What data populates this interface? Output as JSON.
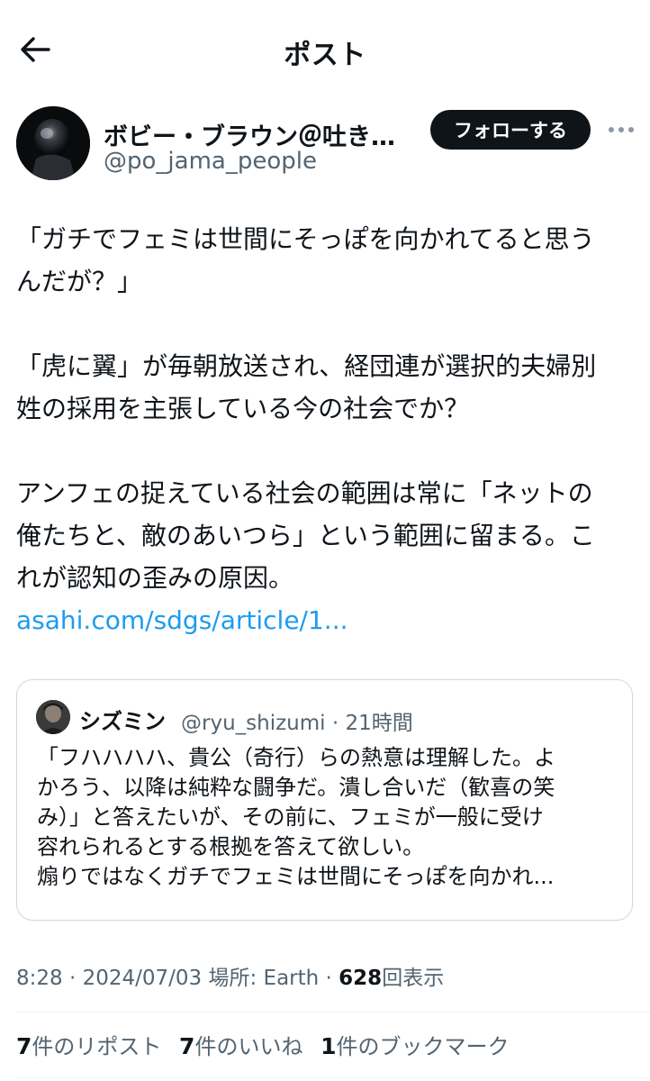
{
  "header": {
    "title": "ポスト",
    "back_icon": "arrow-left-icon"
  },
  "author": {
    "display_name": "ボビー・ブラウン＠吐き気…",
    "handle": "@po_jama_people",
    "follow_label": "フォローする",
    "more_icon": "more-horizontal-icon"
  },
  "post": {
    "lines": [
      "「ガチでフェミは世間にそっぽを向かれてると思う",
      "んだが？」",
      "",
      "「虎に翼」が毎朝放送され、経団連が選択的夫婦別",
      "姓の採用を主張している今の社会でか？",
      "",
      "アンフェの捉えている社会の範囲は常に「ネットの",
      "俺たちと、敵のあいつら」という範囲に留まる。こ",
      "れが認知の歪みの原因。"
    ],
    "link": "asahi.com/sdgs/article/1..."
  },
  "quote": {
    "name": "シズミン",
    "handle": "@ryu_shizumi",
    "time": "21時間",
    "lines": [
      "「フハハハハ、貴公（奇行）らの熱意は理解した。よ",
      "かろう、以降は純粋な闘争だ。潰し合いだ（歓喜の笑",
      "み）」と答えたいが、その前に、フェミが一般に受け",
      "容れられるとする根拠を答えて欲しい。",
      "煽りではなくガチでフェミは世間にそっぽを向かれ..."
    ]
  },
  "meta": {
    "time": "8:28",
    "date": "2024/07/03",
    "location_label": "場所: Earth",
    "views_count": "628",
    "views_label": "回表示"
  },
  "stats": [
    {
      "count": "7",
      "label": "件のリポスト"
    },
    {
      "count": "7",
      "label": "件のいいね"
    },
    {
      "count": "1",
      "label": "件のブックマーク"
    }
  ],
  "colors": {
    "text": "#0f1419",
    "secondary": "#536471",
    "link": "#1d9bf0",
    "border": "#cfd9de",
    "button": "#0f1419"
  }
}
